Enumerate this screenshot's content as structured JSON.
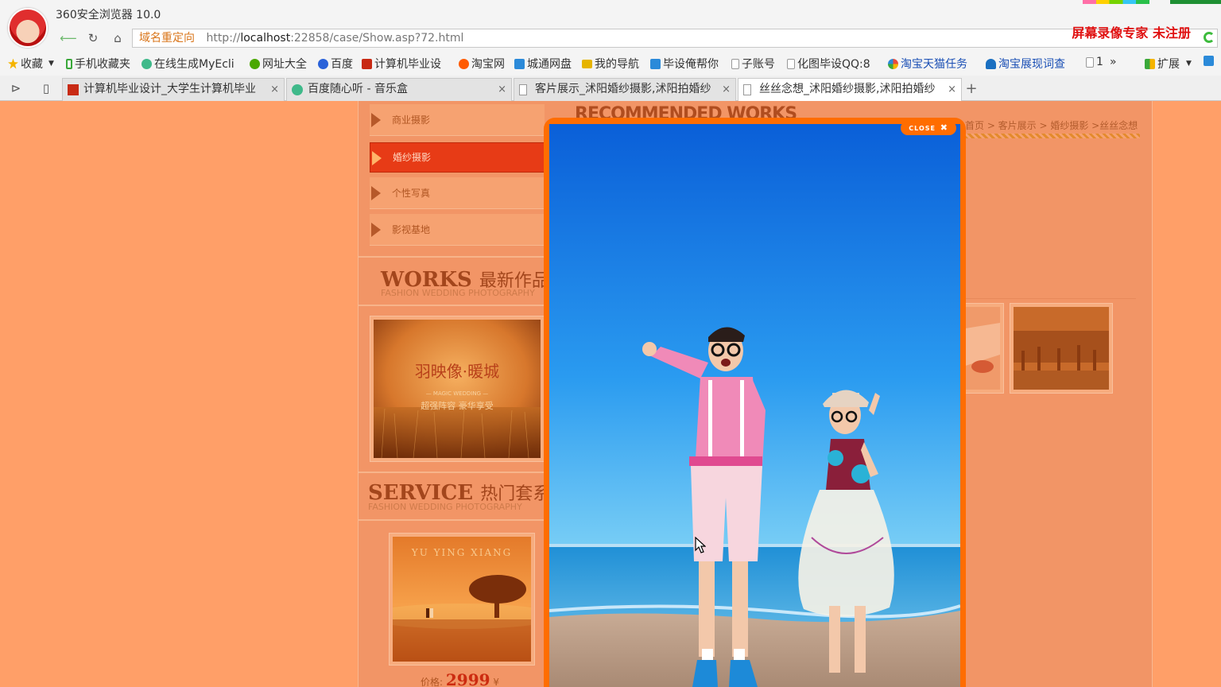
{
  "browser": {
    "app_title": "360安全浏览器 10.0",
    "recorder_brand": "屏幕录像专家  未注册",
    "address": {
      "redirect_label": "域名重定向",
      "url_prefix": "http://",
      "url_host": "localhost",
      "url_suffix": ":22858/case/Show.asp?72.html"
    },
    "bookmarks": [
      {
        "label": "收藏",
        "icon": "star-icon",
        "color": "#f5b400"
      },
      {
        "label": "手机收藏夹",
        "icon": "phone-icon",
        "color": "#3aa83a"
      },
      {
        "label": "在线生成MyEcli",
        "icon": "gear-icon",
        "color": "#3fb98a"
      },
      {
        "label": "网址大全",
        "icon": "ie-icon",
        "color": "#4aa800"
      },
      {
        "label": "百度",
        "icon": "paw-icon",
        "color": "#2a62d9"
      },
      {
        "label": "计算机毕业设",
        "icon": "bi-icon",
        "color": "#c82a14"
      },
      {
        "label": "淘宝网",
        "icon": "taobao-icon",
        "color": "#ff5a00"
      },
      {
        "label": "城通网盘",
        "icon": "ct-icon",
        "color": "#2b8ad9"
      },
      {
        "label": "我的导航",
        "icon": "folder-icon",
        "color": "#e6b400"
      },
      {
        "label": "毕设俺帮你",
        "icon": "chat-icon",
        "color": "#2b8ad9"
      },
      {
        "label": "子账号",
        "icon": "page-icon",
        "color": "#999999"
      },
      {
        "label": "化图毕设QQ:8",
        "icon": "page-icon",
        "color": "#999999"
      },
      {
        "label": "淘宝天猫任务",
        "icon": "pinwheel-icon",
        "color": "#e84c3d"
      },
      {
        "label": "淘宝展现词查",
        "icon": "headset-icon",
        "color": "#1a6fc1"
      },
      {
        "label": "1",
        "icon": "page-icon",
        "color": "#999999"
      },
      {
        "label": "扩展",
        "icon": "grid-icon",
        "color": "#3aa83a"
      }
    ],
    "tabs": [
      {
        "title": "计算机毕业设计_大学生计算机毕业",
        "icon": "bi-icon",
        "active": false
      },
      {
        "title": "百度随心听 - 音乐盒",
        "icon": "gear-icon",
        "active": false
      },
      {
        "title": "客片展示_沭阳婚纱摄影,沭阳拍婚纱",
        "icon": "page-icon",
        "active": false
      },
      {
        "title": "丝丝念想_沭阳婚纱摄影,沭阳拍婚纱",
        "icon": "page-icon",
        "active": true
      }
    ]
  },
  "page": {
    "menu": [
      {
        "label": "商业摄影",
        "active": false
      },
      {
        "label": "婚纱摄影",
        "active": true
      },
      {
        "label": "个性写真",
        "active": false
      },
      {
        "label": "影视基地",
        "active": false
      }
    ],
    "works": {
      "title_en": "WORKS",
      "title_cn": "最新作品",
      "subtitle": "FASHION WEDDING PHOTOGRAPHY"
    },
    "service": {
      "title_en": "SERVICE",
      "title_cn": "热门套系",
      "subtitle": "FASHION WEDDING PHOTOGRAPHY",
      "price_label": "价格:",
      "price_value": "2999",
      "currency": "¥"
    },
    "recommended_title": "RECOMMENDED WORKS",
    "breadcrumb": "首页 > 客片展示 > 婚纱摄影 >丝丝念想",
    "thumb_text": {
      "title": "羽映像·暖城",
      "line1": "— MAGIC WEDDING —",
      "line2": "超强阵容  豪华享受",
      "service_banner": "YU YING XIANG"
    }
  },
  "lightbox": {
    "close_label": "CLOSE"
  }
}
